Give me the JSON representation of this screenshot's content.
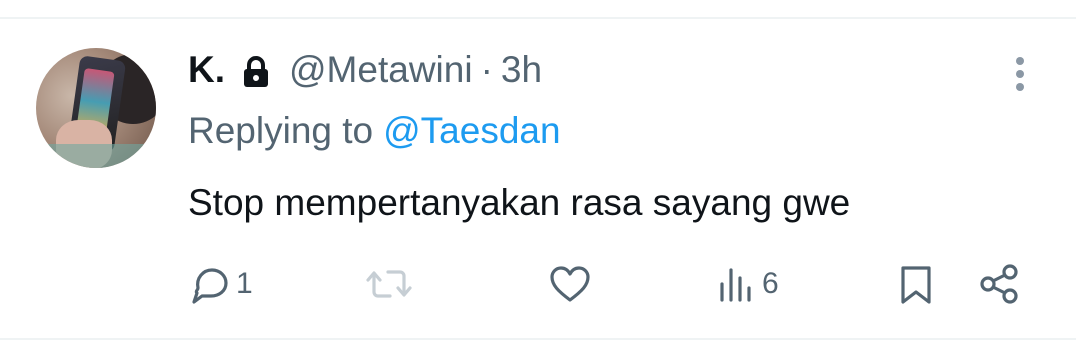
{
  "tweet": {
    "author_name": "K.",
    "author_handle": "@Metawini",
    "separator": "·",
    "time": "3h",
    "replying_prefix": "Replying to",
    "replying_to": "@Taesdan",
    "text": "Stop mempertanyakan rasa sayang gwe"
  },
  "actions": {
    "reply_count": "1",
    "retweet_count": "",
    "like_count": "",
    "views_count": "6"
  },
  "icons": [
    "lock-icon",
    "more-icon",
    "reply-icon",
    "retweet-icon",
    "like-icon",
    "views-icon",
    "bookmark-icon",
    "share-icon"
  ],
  "colors": {
    "text": "#0f1419",
    "secondary": "#536471",
    "link": "#1d9bf0",
    "divider": "#eff3f4"
  }
}
